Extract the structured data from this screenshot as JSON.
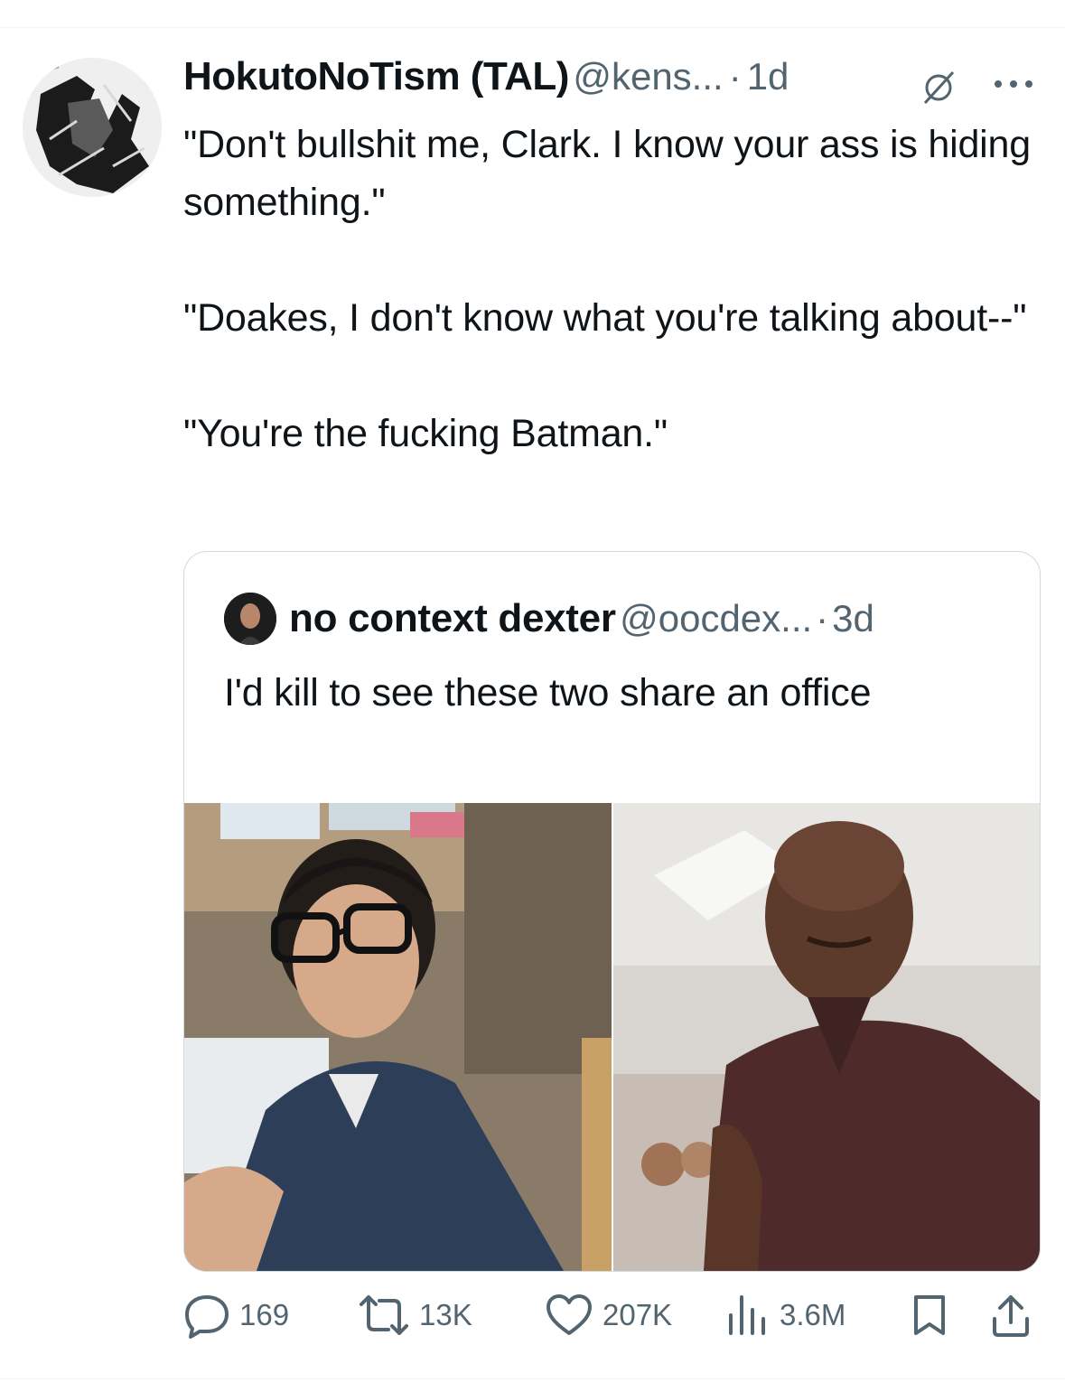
{
  "tweet": {
    "display_name": "HokutoNoTism (TAL)",
    "handle": "@kens...",
    "separator": "·",
    "time": "1d",
    "text": "\"Don't bullshit me, Clark. I know your ass is hiding something.\"\n\n\"Doakes, I don't know what you're talking about--\"\n\n\"You're the fucking Batman.\""
  },
  "quote": {
    "display_name": "no context dexter",
    "handle": "@oocdex...",
    "separator": "·",
    "time": "3d",
    "text": "I'd kill to see these two share an office"
  },
  "actions": {
    "replies": "169",
    "reposts": "13K",
    "likes": "207K",
    "views": "3.6M"
  },
  "icons": [
    "grok-icon",
    "more-icon",
    "reply-icon",
    "repost-icon",
    "like-icon",
    "views-icon",
    "bookmark-icon",
    "share-icon"
  ],
  "colors": {
    "text": "#0f1419",
    "secondary": "#536471",
    "border": "#cfd9de"
  }
}
